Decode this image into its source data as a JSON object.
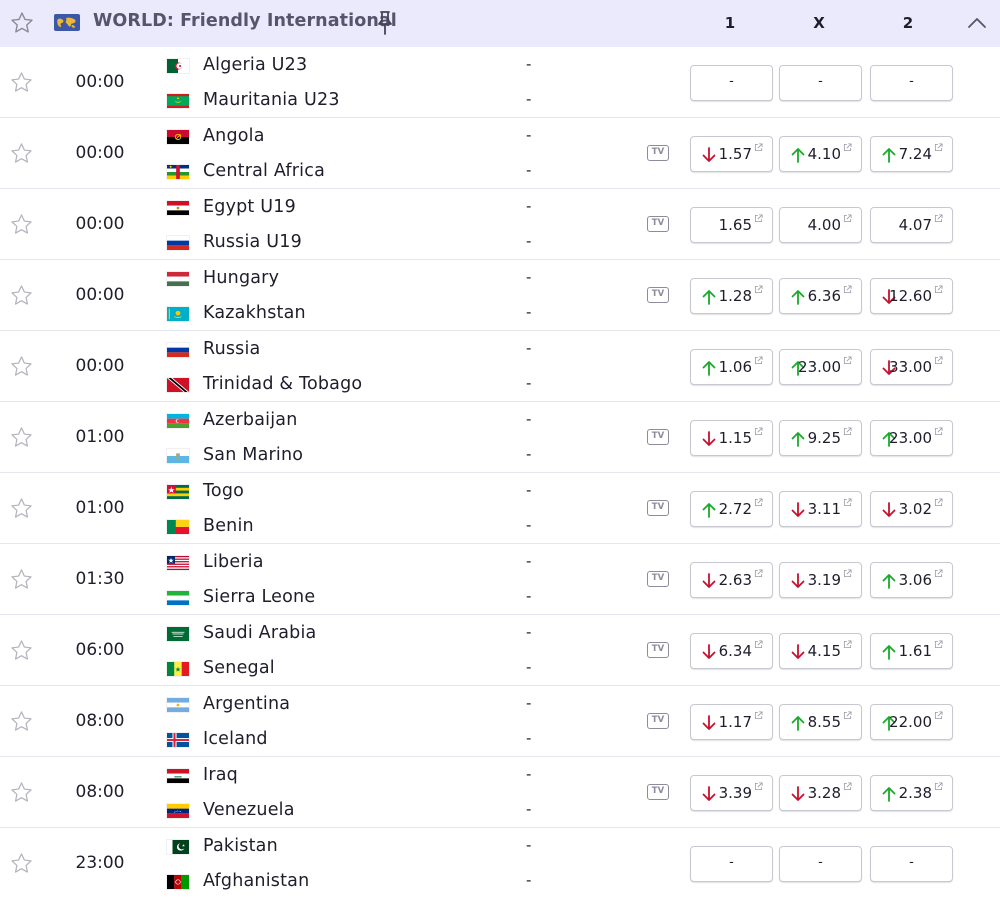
{
  "header": {
    "title": "WORLD: Friendly International",
    "col1": "1",
    "colx": "X",
    "col2": "2"
  },
  "matches": [
    {
      "time": "00:00",
      "home": "Algeria U23",
      "away": "Mauritania U23",
      "home_score": "-",
      "away_score": "-",
      "tv": false,
      "home_flag": "algeria",
      "away_flag": "mauritania",
      "odds": [
        {
          "value": "-",
          "trend": "none"
        },
        {
          "value": "-",
          "trend": "none"
        },
        {
          "value": "-",
          "trend": "none"
        }
      ]
    },
    {
      "time": "00:00",
      "home": "Angola",
      "away": "Central Africa",
      "home_score": "-",
      "away_score": "-",
      "tv": true,
      "home_flag": "angola",
      "away_flag": "central-africa",
      "odds": [
        {
          "value": "1.57",
          "trend": "down"
        },
        {
          "value": "4.10",
          "trend": "up"
        },
        {
          "value": "7.24",
          "trend": "up"
        }
      ]
    },
    {
      "time": "00:00",
      "home": "Egypt U19",
      "away": "Russia U19",
      "home_score": "-",
      "away_score": "-",
      "tv": true,
      "home_flag": "egypt",
      "away_flag": "russia",
      "odds": [
        {
          "value": "1.65",
          "trend": "none"
        },
        {
          "value": "4.00",
          "trend": "none"
        },
        {
          "value": "4.07",
          "trend": "none"
        }
      ]
    },
    {
      "time": "00:00",
      "home": "Hungary",
      "away": "Kazakhstan",
      "home_score": "-",
      "away_score": "-",
      "tv": true,
      "home_flag": "hungary",
      "away_flag": "kazakhstan",
      "odds": [
        {
          "value": "1.28",
          "trend": "up"
        },
        {
          "value": "6.36",
          "trend": "up"
        },
        {
          "value": "12.60",
          "trend": "down"
        }
      ]
    },
    {
      "time": "00:00",
      "home": "Russia",
      "away": "Trinidad & Tobago",
      "home_score": "-",
      "away_score": "-",
      "tv": false,
      "home_flag": "russia",
      "away_flag": "trinidad",
      "odds": [
        {
          "value": "1.06",
          "trend": "up"
        },
        {
          "value": "23.00",
          "trend": "up"
        },
        {
          "value": "33.00",
          "trend": "down"
        }
      ]
    },
    {
      "time": "01:00",
      "home": "Azerbaijan",
      "away": "San Marino",
      "home_score": "-",
      "away_score": "-",
      "tv": true,
      "home_flag": "azerbaijan",
      "away_flag": "san-marino",
      "odds": [
        {
          "value": "1.15",
          "trend": "down"
        },
        {
          "value": "9.25",
          "trend": "up"
        },
        {
          "value": "23.00",
          "trend": "up"
        }
      ]
    },
    {
      "time": "01:00",
      "home": "Togo",
      "away": "Benin",
      "home_score": "-",
      "away_score": "-",
      "tv": true,
      "home_flag": "togo",
      "away_flag": "benin",
      "odds": [
        {
          "value": "2.72",
          "trend": "up"
        },
        {
          "value": "3.11",
          "trend": "down"
        },
        {
          "value": "3.02",
          "trend": "down"
        }
      ]
    },
    {
      "time": "01:30",
      "home": "Liberia",
      "away": "Sierra Leone",
      "home_score": "-",
      "away_score": "-",
      "tv": true,
      "home_flag": "liberia",
      "away_flag": "sierra-leone",
      "odds": [
        {
          "value": "2.63",
          "trend": "down"
        },
        {
          "value": "3.19",
          "trend": "down"
        },
        {
          "value": "3.06",
          "trend": "up"
        }
      ]
    },
    {
      "time": "06:00",
      "home": "Saudi Arabia",
      "away": "Senegal",
      "home_score": "-",
      "away_score": "-",
      "tv": true,
      "home_flag": "saudi-arabia",
      "away_flag": "senegal",
      "odds": [
        {
          "value": "6.34",
          "trend": "down"
        },
        {
          "value": "4.15",
          "trend": "down"
        },
        {
          "value": "1.61",
          "trend": "up"
        }
      ]
    },
    {
      "time": "08:00",
      "home": "Argentina",
      "away": "Iceland",
      "home_score": "-",
      "away_score": "-",
      "tv": true,
      "home_flag": "argentina",
      "away_flag": "iceland",
      "odds": [
        {
          "value": "1.17",
          "trend": "down"
        },
        {
          "value": "8.55",
          "trend": "up"
        },
        {
          "value": "22.00",
          "trend": "up"
        }
      ]
    },
    {
      "time": "08:00",
      "home": "Iraq",
      "away": "Venezuela",
      "home_score": "-",
      "away_score": "-",
      "tv": true,
      "home_flag": "iraq",
      "away_flag": "venezuela",
      "odds": [
        {
          "value": "3.39",
          "trend": "down"
        },
        {
          "value": "3.28",
          "trend": "down"
        },
        {
          "value": "2.38",
          "trend": "up"
        }
      ]
    },
    {
      "time": "23:00",
      "home": "Pakistan",
      "away": "Afghanistan",
      "home_score": "-",
      "away_score": "-",
      "tv": false,
      "home_flag": "pakistan",
      "away_flag": "afghanistan",
      "odds": [
        {
          "value": "-",
          "trend": "none"
        },
        {
          "value": "-",
          "trend": "none"
        },
        {
          "value": "-",
          "trend": "none"
        }
      ]
    }
  ],
  "tv_label": "TV",
  "colors": {
    "up": "#1aaa2a",
    "down": "#c8102e",
    "header_bg": "#eaeafc"
  }
}
